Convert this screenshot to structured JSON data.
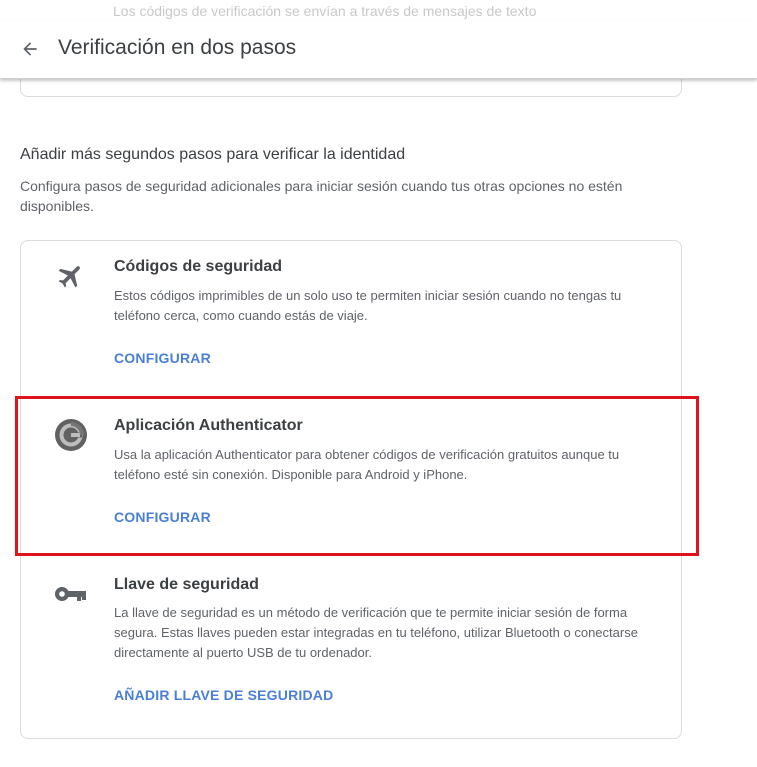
{
  "behind_text": "Los códigos de verificación se envían a través de mensajes de texto",
  "header": {
    "title": "Verificación en dos pasos",
    "back_icon": "arrow-back-icon"
  },
  "section": {
    "title": "Añadir más segundos pasos para verificar la identidad",
    "description": "Configura pasos de seguridad adicionales para iniciar sesión cuando tus otras opciones no estén disponibles."
  },
  "options": [
    {
      "icon": "airplane-icon",
      "title": "Códigos de seguridad",
      "description": "Estos códigos imprimibles de un solo uso te permiten iniciar sesión cuando no tengas tu teléfono cerca, como cuando estás de viaje.",
      "action": "CONFIGURAR"
    },
    {
      "icon": "authenticator-icon",
      "title": "Aplicación Authenticator",
      "description": "Usa la aplicación Authenticator para obtener códigos de verificación gratuitos aunque tu teléfono esté sin conexión. Disponible para Android y iPhone.",
      "action": "CONFIGURAR"
    },
    {
      "icon": "key-icon",
      "title": "Llave de seguridad",
      "description": "La llave de seguridad es un método de verificación que te permite iniciar sesión de forma segura. Estas llaves pueden estar integradas en tu teléfono, utilizar Bluetooth o conectarse directamente al puerto USB de tu ordenador.",
      "action": "AÑADIR LLAVE DE SEGURIDAD"
    }
  ],
  "colors": {
    "link": "#4a7fd6",
    "highlight": "#e0141e"
  }
}
